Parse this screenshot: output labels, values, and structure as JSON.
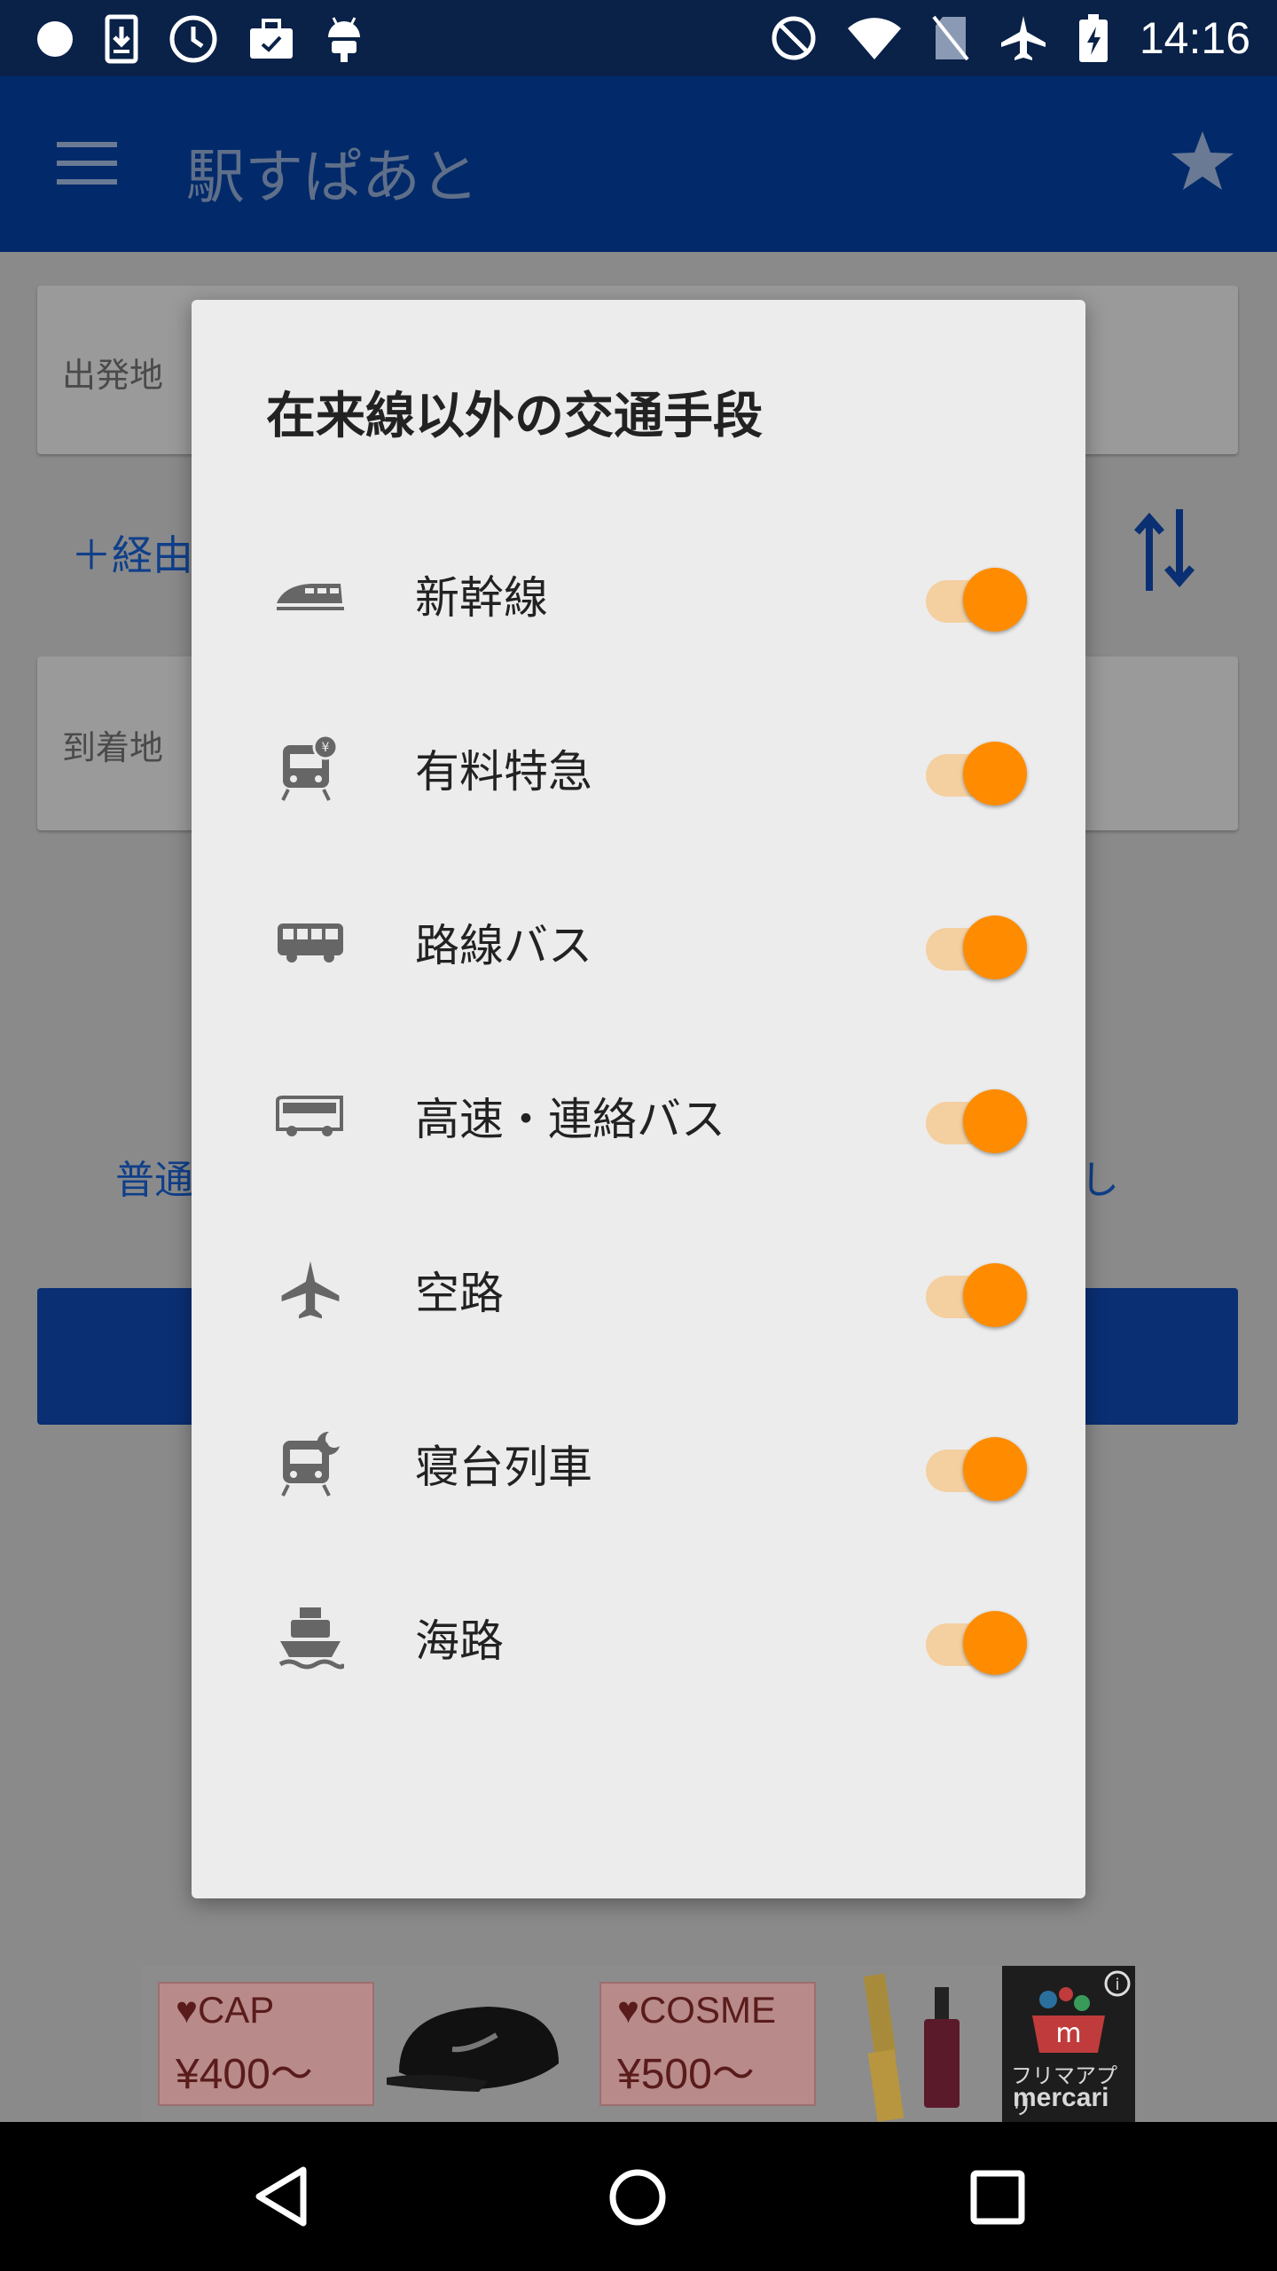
{
  "status_bar": {
    "time": "14:16",
    "left_icons": [
      "circle-icon",
      "download-icon",
      "clock-icon",
      "briefcase-icon",
      "android-icon"
    ],
    "right_icons": [
      "do-not-disturb-icon",
      "wifi-icon",
      "no-sim-icon",
      "airplane-icon",
      "battery-charging-icon"
    ]
  },
  "app_bar": {
    "title": "駅すぱあと"
  },
  "background": {
    "departure_label": "出発地",
    "arrival_label": "到着地",
    "add_via_label": "＋経由",
    "ordinary_text": "普通",
    "right_text": "し"
  },
  "dialog": {
    "title": "在来線以外の交通手段",
    "options": [
      {
        "label": "新幹線",
        "icon": "bullet-train-icon",
        "enabled": true
      },
      {
        "label": "有料特急",
        "icon": "paid-express-icon",
        "enabled": true
      },
      {
        "label": "路線バス",
        "icon": "bus-icon",
        "enabled": true
      },
      {
        "label": "高速・連絡バス",
        "icon": "highway-bus-icon",
        "enabled": true
      },
      {
        "label": "空路",
        "icon": "airplane-icon",
        "enabled": true
      },
      {
        "label": "寝台列車",
        "icon": "sleeper-train-icon",
        "enabled": true
      },
      {
        "label": "海路",
        "icon": "ship-icon",
        "enabled": true
      }
    ]
  },
  "ad": {
    "tile1_line1": "♥CAP",
    "tile1_line2": "¥400〜",
    "tile2_line1": "♥COSME",
    "tile2_line2": "¥500〜",
    "brand_line1": "フリマアプリ",
    "brand_line2": "mercari"
  },
  "colors": {
    "status_bar": "#0a2148",
    "app_bar": "#022a6a",
    "switch_thumb": "#ff8c00",
    "switch_track": "#f4cfa0",
    "dialog_bg": "#ececec"
  }
}
